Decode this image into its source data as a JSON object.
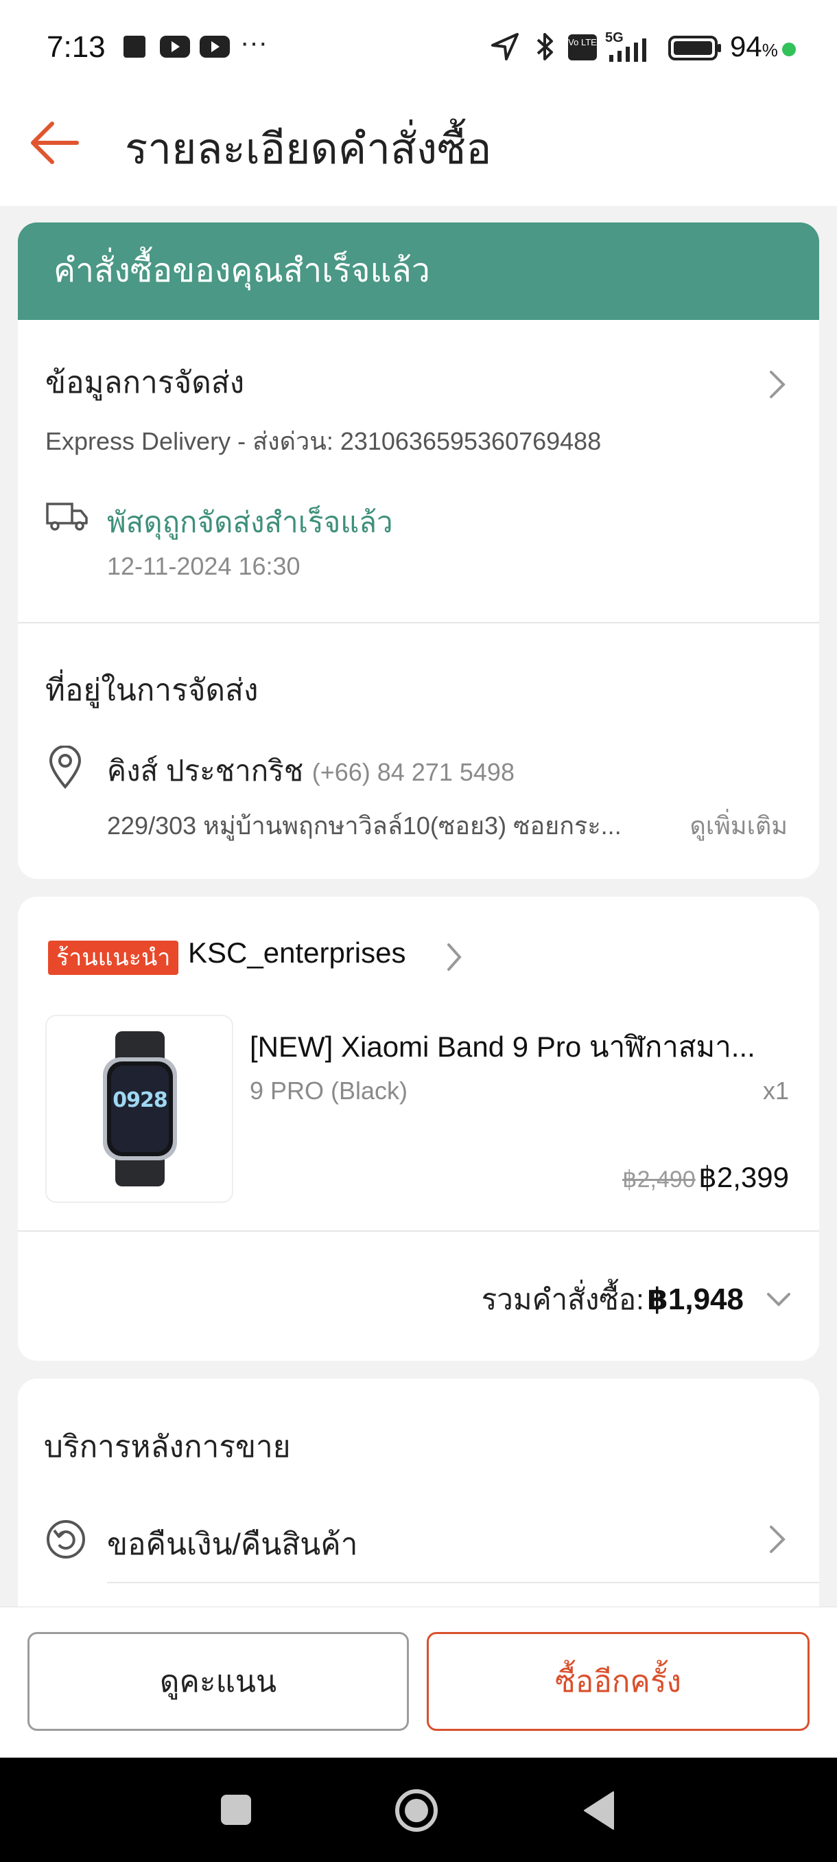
{
  "status_bar": {
    "time": "7:13",
    "battery_percent": "94",
    "battery_symbol": "%",
    "network": "5G",
    "volte": "Vo LTE",
    "more": "···"
  },
  "header": {
    "title": "รายละเอียดคำสั่งซื้อ"
  },
  "banner": {
    "text": "คำสั่งซื้อของคุณสำเร็จแล้ว"
  },
  "shipping": {
    "title": "ข้อมูลการจัดส่ง",
    "carrier_line": "Express Delivery - ส่งด่วน: 2310636595360769488",
    "status": "พัสดุถูกจัดส่งสำเร็จแล้ว",
    "timestamp": "12-11-2024 16:30"
  },
  "address": {
    "title": "ที่อยู่ในการจัดส่ง",
    "name": "คิงส์ ประชากริช",
    "phone": "(+66) 84 271 5498",
    "line": "229/303 หมู่บ้านพฤกษาวิลล์10(ซอย3) ซอยกระ...",
    "see_more": "ดูเพิ่มเติม"
  },
  "order": {
    "store_badge": "ร้านแนะนำ",
    "store_name": "KSC_enterprises",
    "product_name": "[NEW] Xiaomi Band 9 Pro นาฬิกาสมา...",
    "variant": "9 PRO (Black)",
    "quantity": "x1",
    "original_price": "฿2,490",
    "price": "฿2,399",
    "total_label": "รวมคำสั่งซื้อ:",
    "total_value": "฿1,948",
    "watch_time": "0928"
  },
  "after_sales": {
    "title": "บริการหลังการขาย",
    "refund_label": "ขอคืนเงิน/คืนสินค้า"
  },
  "actions": {
    "rate_label": "ดูคะแนน",
    "buy_again_label": "ซื้ออีกครั้ง"
  },
  "colors": {
    "accent": "#d9502c",
    "banner": "#4a9885",
    "status_green": "#3e8f7a",
    "badge": "#e8492b"
  }
}
